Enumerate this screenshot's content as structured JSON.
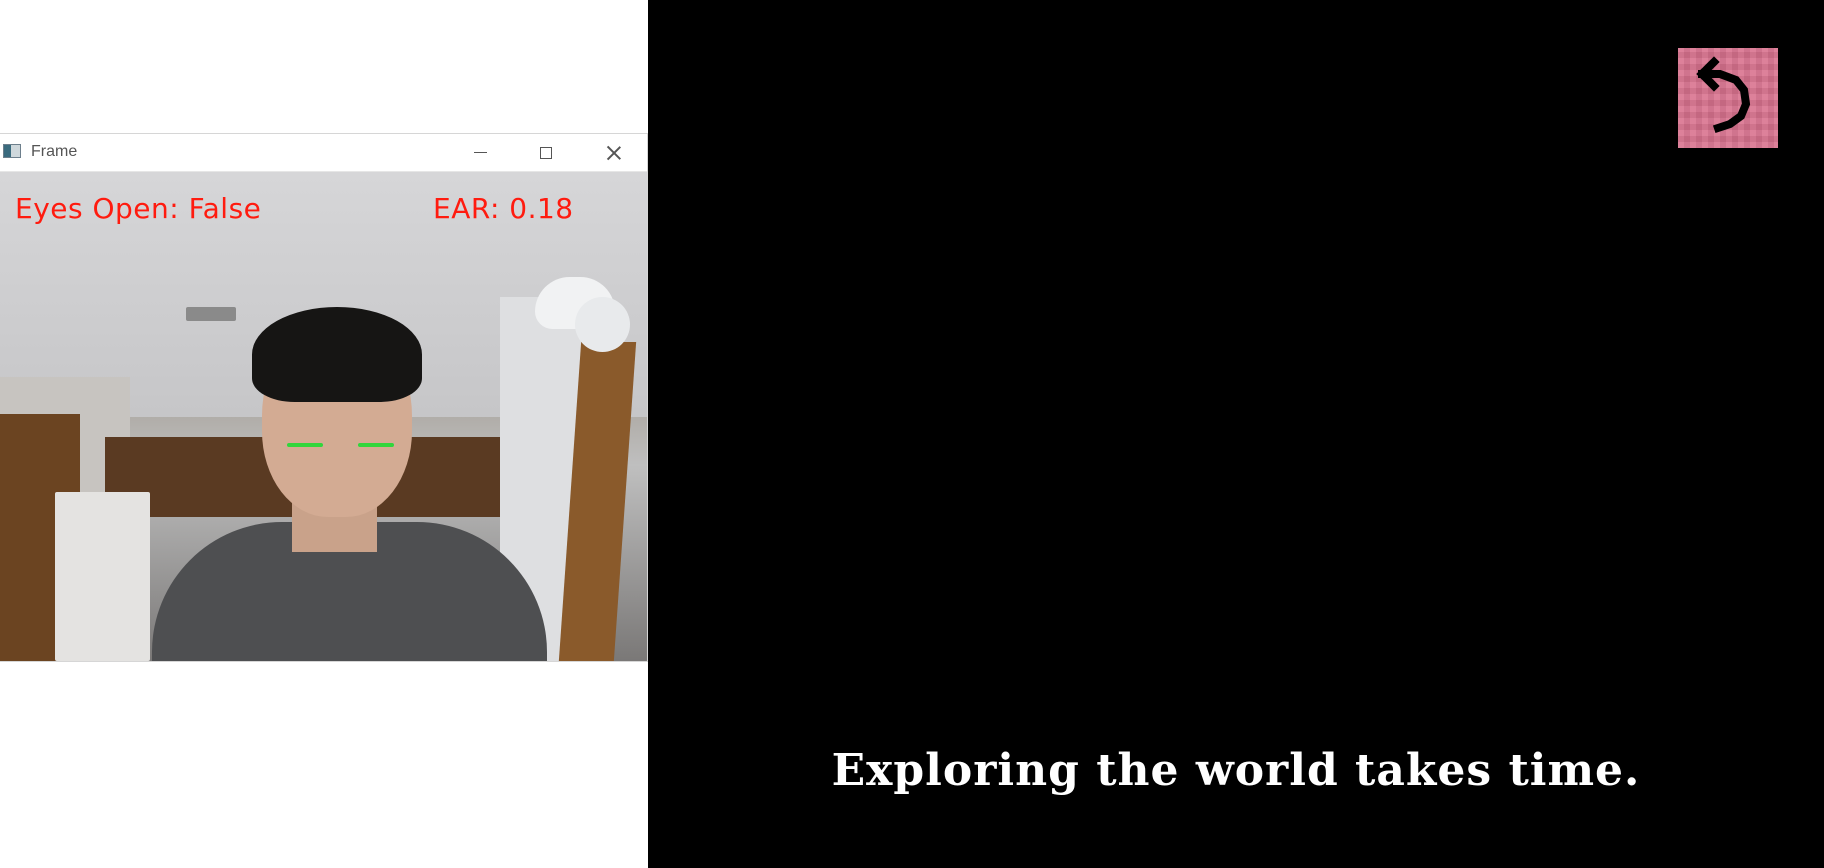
{
  "frame_window": {
    "title": "Frame",
    "overlay": {
      "eyes_open_text": "Eyes Open: False",
      "ear_text": "EAR: 0.18",
      "text_color": "#ff1b0f",
      "eye_marker_color": "#31d63c"
    },
    "controls": {
      "minimize_icon": "minimize-icon",
      "maximize_icon": "maximize-icon",
      "close_icon": "close-icon"
    }
  },
  "game": {
    "subtitle": "Exploring the world takes time.",
    "undo_button_icon": "undo-icon",
    "undo_button_color": "#d9738f"
  }
}
